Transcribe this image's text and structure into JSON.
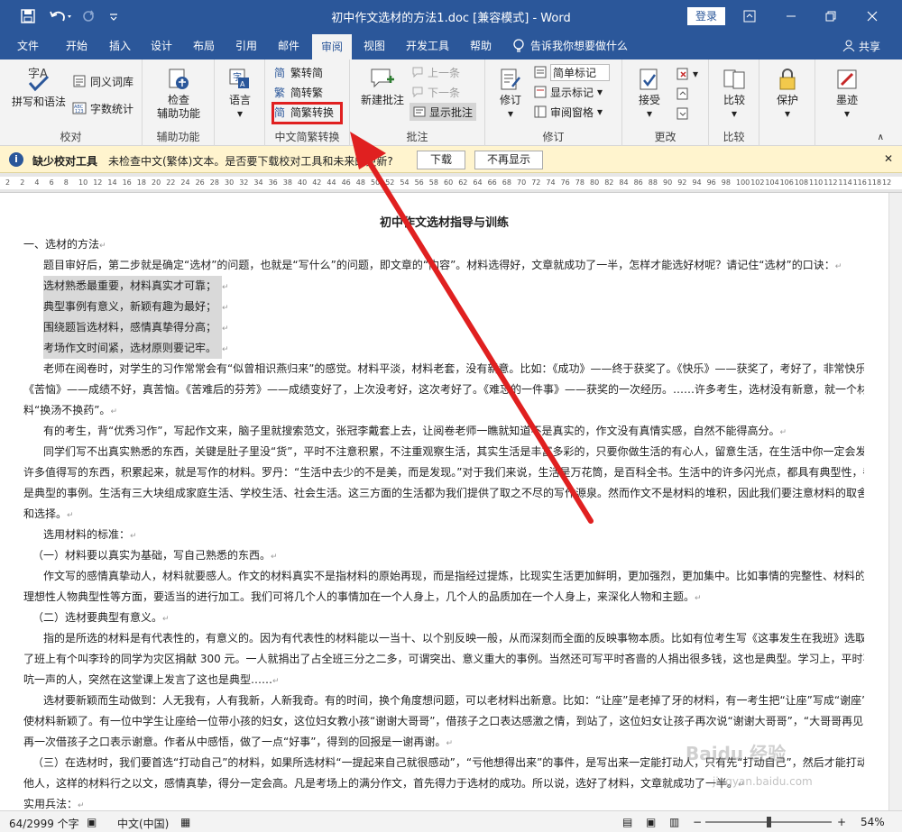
{
  "window": {
    "title": "初中作文选材的方法1.doc [兼容模式] - Word",
    "login_label": "登录"
  },
  "tabs": [
    {
      "label": "文件"
    },
    {
      "label": "开始"
    },
    {
      "label": "插入"
    },
    {
      "label": "设计"
    },
    {
      "label": "布局"
    },
    {
      "label": "引用"
    },
    {
      "label": "邮件"
    },
    {
      "label": "审阅"
    },
    {
      "label": "视图"
    },
    {
      "label": "开发工具"
    },
    {
      "label": "帮助"
    }
  ],
  "tellme": "告诉我你想要做什么",
  "share": "共享",
  "ribbon": {
    "proofing": {
      "spelling": "拼写和语法",
      "thesaurus": "同义词库",
      "wordcount": "字数统计",
      "label": "校对"
    },
    "accessibility": {
      "check_line1": "检查",
      "check_line2": "辅助功能",
      "label": "辅助功能"
    },
    "language": {
      "button": "语言",
      "label": ""
    },
    "chinese": {
      "to_simplified": "繁转简",
      "to_traditional": "简转繁",
      "convert": "简繁转换",
      "label": "中文简繁转换"
    },
    "comments": {
      "new": "新建批注",
      "prev": "上一条",
      "next": "下一条",
      "show": "显示批注",
      "label": "批注"
    },
    "tracking": {
      "track": "修订",
      "markup": "简单标记",
      "show_markup": "显示标记",
      "pane": "审阅窗格",
      "label": "修订"
    },
    "changes": {
      "accept": "接受",
      "label": "更改"
    },
    "compare": {
      "compare": "比较",
      "label": "比较"
    },
    "protect": {
      "protect": "保护",
      "label": ""
    },
    "ink": {
      "ink": "墨迹",
      "label": ""
    }
  },
  "infobar": {
    "title": "缺少校对工具",
    "message": "未检查中文(繁体)文本。是否要下载校对工具和未来的更新?",
    "download": "下载",
    "dismiss": "不再显示"
  },
  "ruler": [
    "2",
    "2",
    "4",
    "6",
    "8",
    "10",
    "12",
    "14",
    "16",
    "18",
    "20",
    "22",
    "24",
    "26",
    "28",
    "30",
    "32",
    "34",
    "36",
    "38",
    "40",
    "42",
    "44",
    "46",
    "48",
    "50",
    "52",
    "54",
    "56",
    "58",
    "60",
    "62",
    "64",
    "66",
    "68",
    "70",
    "72",
    "74",
    "76",
    "78",
    "80",
    "82",
    "84",
    "86",
    "88",
    "90",
    "92",
    "94",
    "96",
    "98",
    "100",
    "102",
    "104",
    "106",
    "108",
    "110",
    "112",
    "114",
    "116",
    "118",
    "12"
  ],
  "document": {
    "heading": "初中作文选材指导与训练",
    "lines": [
      "一、选材的方法",
      "题目审好后，第二步就是确定“选材”的问题，也就是“写什么”的问题，即文章的“内容”。材料选得好，文章就成功了一半，怎样才能选好材呢？请记住“选材”的口诀：",
      "选材熟悉最重要，材料真实才可靠；",
      "典型事例有意义，新颖有趣为最好；",
      "围绕题旨选材料，感情真挚得分高；",
      "考场作文时间紧，选材原则要记牢。",
      "老师在阅卷时，对学生的习作常常会有“似曾相识燕归来”的感觉。材料平淡，材料老套，没有新意。比如：《成功》——终于获奖了。《快乐》——获奖了，考好了，非常快乐。",
      "《苦恼》——成绩不好，真苦恼。《苦难后的芬芳》——成绩变好了，上次没考好，这次考好了。《难忘的一件事》——获奖的一次经历。……许多考生，选材没有新意，就一个材",
      "料“换汤不换药”。",
      "有的考生，背“优秀习作”，写起作文来，脑子里就搜索范文，张冠李戴套上去，让阅卷老师一瞧就知道不是真实的，作文没有真情实感，自然不能得高分。",
      "同学们写不出真实熟悉的东西，关键是肚子里没“货”，平时不注意积累，不注重观察生活，其实生活是丰富多彩的，只要你做生活的有心人，留意生活，在生活中你一定会发现",
      "许多值得写的东西，积累起来，就是写作的材料。罗丹：“生活中去少的不是美，而是发现。”对于我们来说，生活是万花筒，是百科全书。生活中的许多闪光点，都具有典型性，都",
      "是典型的事例。生活有三大块组成家庭生活、学校生活、社会生活。这三方面的生活都为我们提供了取之不尽的写作源泉。然而作文不是材料的堆积，因此我们要注意材料的取舍",
      "和选择。",
      "选用材料的标准：",
      "（一）材料要以真实为基础，写自己熟悉的东西。",
      "作文写的感情真挚动人，材料就要感人。作文的材料真实不是指材料的原始再现，而是指经过提炼，比现实生活更加鲜明，更加强烈，更加集中。比如事情的完整性、材料的",
      "理想性人物典型性等方面，要适当的进行加工。我们可将几个人的事情加在一个人身上，几个人的品质加在一个人身上，来深化人物和主题。",
      "（二）选材要典型有意义。",
      "指的是所选的材料是有代表性的，有意义的。因为有代表性的材料能以一当十、以个别反映一般，从而深刻而全面的反映事物本质。比如有位考生写《这事发生在我班》选取",
      "了班上有个叫李玲的同学为灾区捐献 300 元。一人就捐出了占全班三分之二多，可谓突出、意义重大的事例。当然还可写平时吝啬的人捐出很多钱，这也是典型。学习上，平时不",
      "吭一声的人，突然在这堂课上发言了这也是典型……",
      "选材要新颖而生动做到：人无我有，人有我新，人新我奇。有的时间，换个角度想问题，可以老材料出新意。比如：“让座”是老掉了牙的材料，有一考生把“让座”写成“谢座”，",
      "使材料新颖了。有一位中学生让座给一位带小孩的妇女，这位妇女教小孩“谢谢大哥哥”，借孩子之口表达感激之情，到站了，这位妇女让孩子再次说“谢谢大哥哥”，“大哥哥再见”，",
      "再一次借孩子之口表示谢意。作者从中感悟，做了一点“好事”，得到的回报是一谢再谢。",
      "（三）在选材时，我们要首选“打动自己”的材料，如果所选材料“一提起来自己就很感动”，“亏他想得出来”的事件，是写出来一定能打动人，只有先“打动自己”，然后才能打动",
      "他人，这样的材料行之以文，感情真挚，得分一定会高。凡是考场上的满分作文，首先得力于选材的成功。所以说，选好了材料，文章就成功了一半。",
      "实用兵法："
    ]
  },
  "status": {
    "words": "64/2999 个字",
    "language": "中文(中国)",
    "zoom": "54%"
  },
  "watermark": {
    "line1": "Baidu 经验",
    "line2": "jingyan.baidu.com"
  },
  "colors": {
    "accent": "#2b579a",
    "highlight": "#e02020",
    "infobar": "#fff4ce"
  }
}
